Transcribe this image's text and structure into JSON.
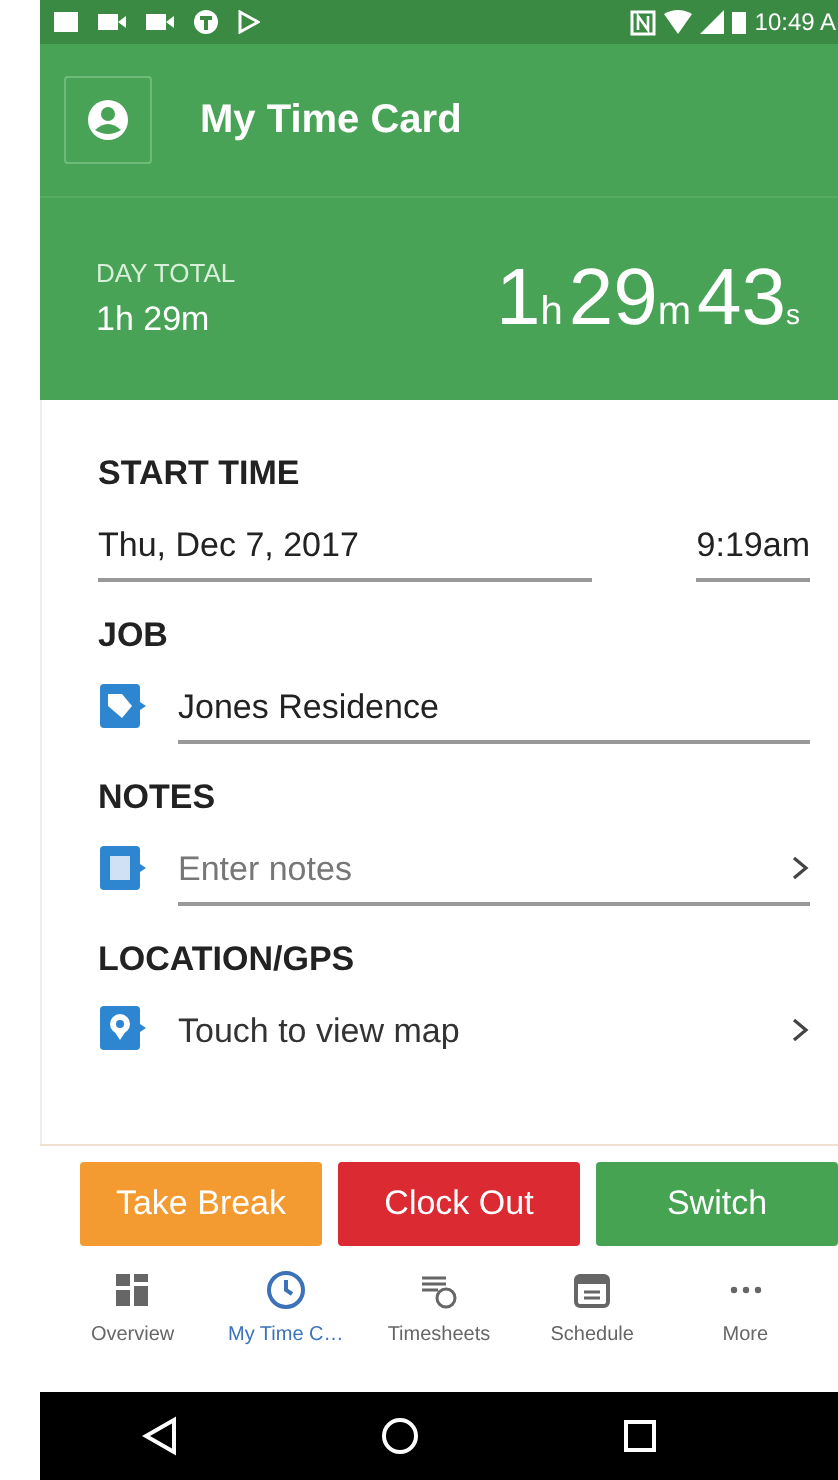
{
  "status_bar": {
    "time": "10:49 A"
  },
  "app_bar": {
    "title": "My Time Card"
  },
  "day_total": {
    "label": "DAY TOTAL",
    "value": "1h 29m",
    "timer": [
      {
        "value": "1",
        "unit": "h"
      },
      {
        "value": "29",
        "unit": "m"
      },
      {
        "value": "43",
        "unit": "s"
      }
    ]
  },
  "sections": [
    {
      "kind": "datetime",
      "label": "START TIME",
      "date": "Thu, Dec 7, 2017",
      "time": "9:19am"
    },
    {
      "kind": "job",
      "label": "JOB",
      "value": "Jones Residence"
    },
    {
      "kind": "notes",
      "label": "NOTES",
      "placeholder": "Enter notes"
    },
    {
      "kind": "location",
      "label": "LOCATION/GPS",
      "value": "Touch to view map"
    }
  ],
  "actions": [
    {
      "label": "Take Break",
      "color": "#f39a31"
    },
    {
      "label": "Clock Out",
      "color": "#dc2a32"
    },
    {
      "label": "Switch",
      "color": "#45a351"
    }
  ],
  "bottom_nav": [
    {
      "label": "Overview",
      "kind": "grid",
      "selected": false
    },
    {
      "label": "My Time C…",
      "kind": "clock",
      "selected": true
    },
    {
      "label": "Timesheets",
      "kind": "list",
      "selected": false
    },
    {
      "label": "Schedule",
      "kind": "calendar",
      "selected": false
    },
    {
      "label": "More",
      "kind": "more",
      "selected": false
    }
  ]
}
